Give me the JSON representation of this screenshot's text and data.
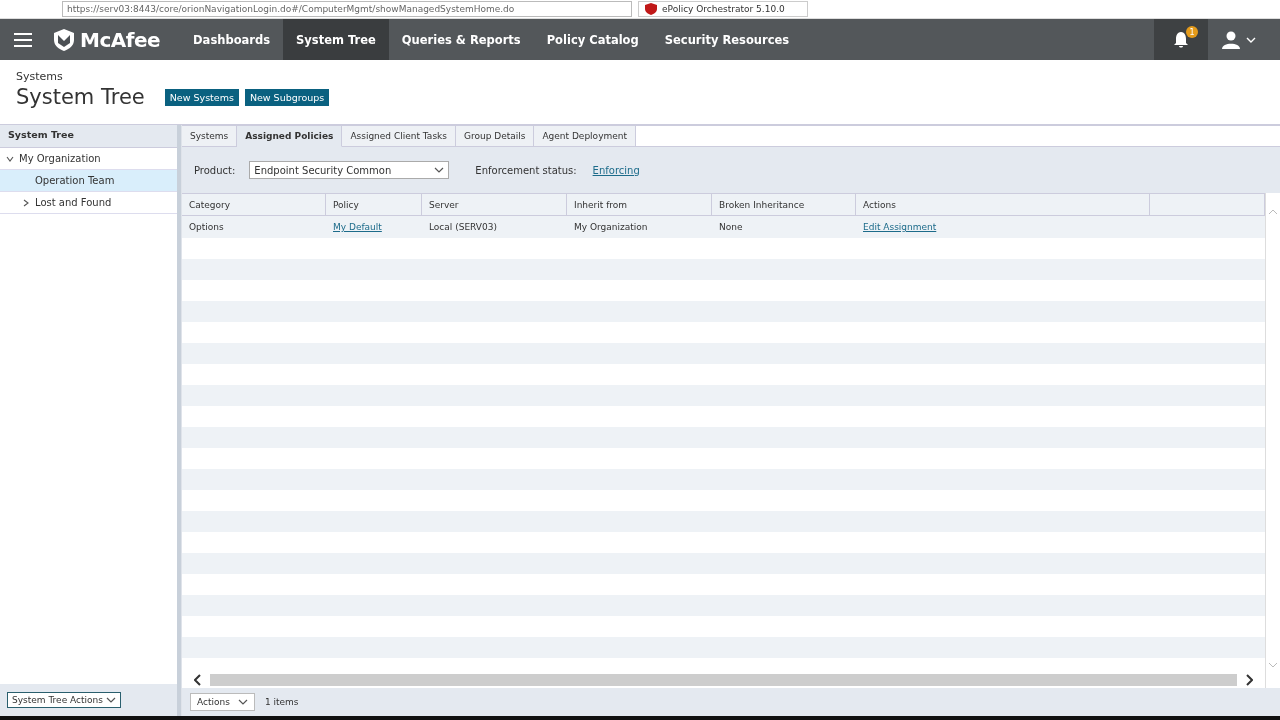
{
  "browser": {
    "url": "https://serv03:8443/core/orionNavigationLogin.do#/ComputerMgmt/showManagedSystemHome.do",
    "tab_title": "ePolicy Orchestrator 5.10.0"
  },
  "nav": {
    "logo": "McAfee",
    "items": [
      {
        "label": "Dashboards",
        "selected": false
      },
      {
        "label": "System Tree",
        "selected": true
      },
      {
        "label": "Queries & Reports",
        "selected": false
      },
      {
        "label": "Policy Catalog",
        "selected": false
      },
      {
        "label": "Security Resources",
        "selected": false
      }
    ],
    "notification_count": "1"
  },
  "header": {
    "breadcrumb": "Systems",
    "title": "System Tree",
    "buttons": [
      "New Systems",
      "New Subgroups"
    ]
  },
  "sidebar": {
    "title": "System Tree",
    "tree": [
      {
        "label": "My Organization",
        "expanded": true,
        "selected": false,
        "children": [
          {
            "label": "Operation Team",
            "selected": true
          },
          {
            "label": "Lost and Found",
            "expanded": false,
            "selected": false
          }
        ]
      }
    ],
    "actions_button": "System Tree Actions"
  },
  "tabs": [
    {
      "label": "Systems",
      "selected": false
    },
    {
      "label": "Assigned Policies",
      "selected": true
    },
    {
      "label": "Assigned Client Tasks",
      "selected": false
    },
    {
      "label": "Group Details",
      "selected": false
    },
    {
      "label": "Agent Deployment",
      "selected": false
    }
  ],
  "filter": {
    "product_label": "Product:",
    "product_value": "Endpoint Security Common",
    "enforcement_label": "Enforcement status:",
    "enforcement_value": "Enforcing"
  },
  "table": {
    "columns": [
      "Category",
      "Policy",
      "Server",
      "Inherit from",
      "Broken Inheritance",
      "Actions"
    ],
    "rows": [
      [
        {
          "text": "Options",
          "kind": "text"
        },
        {
          "text": "My Default",
          "kind": "link"
        },
        {
          "text": "Local (SERV03)",
          "kind": "text"
        },
        {
          "text": "My Organization",
          "kind": "text"
        },
        {
          "text": "None",
          "kind": "text"
        },
        {
          "text": "Edit Assignment",
          "kind": "link"
        }
      ]
    ]
  },
  "footer": {
    "actions_button": "Actions",
    "count": "1 items"
  }
}
